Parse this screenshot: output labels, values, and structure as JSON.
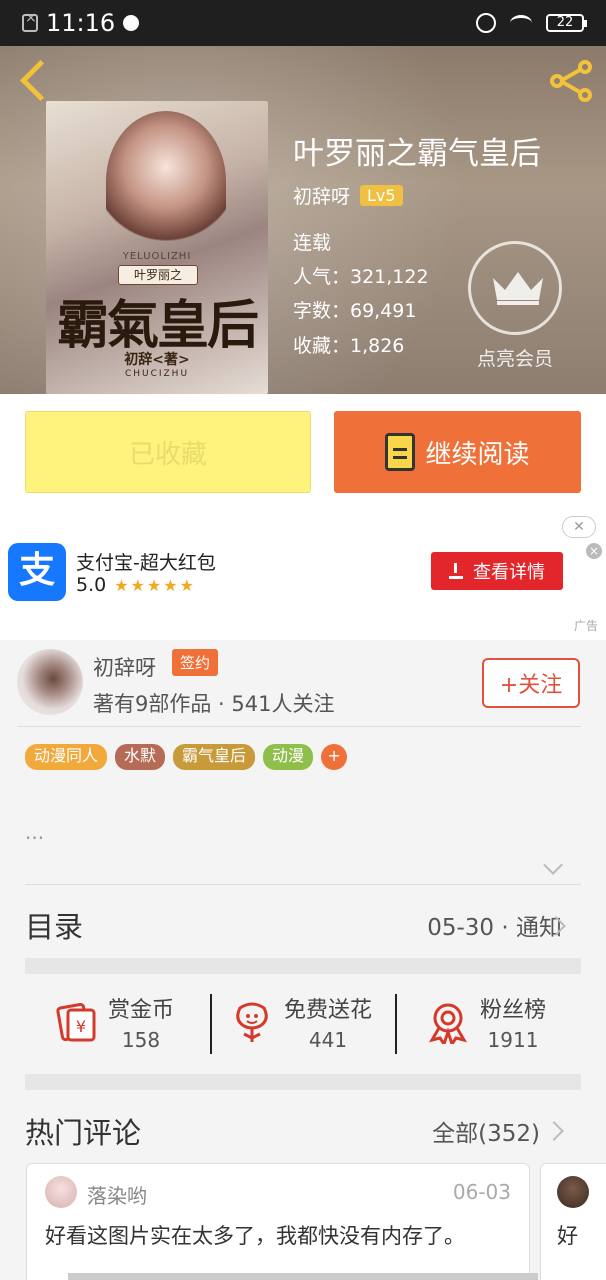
{
  "status_bar": {
    "time": "11:16",
    "battery": "22"
  },
  "book": {
    "title": "叶罗丽之霸气皇后",
    "author": "初辞呀",
    "level": "Lv5",
    "status": "连载",
    "popularity": "人气：321,122",
    "word_count": "字数：69,491",
    "favorites": "收藏：1,826",
    "vip_label": "点亮会员",
    "cover": {
      "subtitle": "YELUOLIZHI",
      "pill": "叶罗丽之",
      "big_title": "霸氣皇后",
      "author": "初辞<著>",
      "pinyin": "CHUCIZHU"
    }
  },
  "actions": {
    "collected": "已收藏",
    "continue_reading": "继续阅读"
  },
  "ad": {
    "close": "✕",
    "logo_char": "支",
    "title": "支付宝-超大红包",
    "rating": "5.0",
    "stars": "★★★★★",
    "button": "查看详情",
    "tag": "广告"
  },
  "author_info": {
    "name": "初辞呀",
    "sign_badge": "签约",
    "stats": "著有9部作品 · 541人关注",
    "follow": "+关注",
    "tags": [
      {
        "label": "动漫同人",
        "color": "#f2a93b"
      },
      {
        "label": "水默",
        "color": "#b56b55"
      },
      {
        "label": "霸气皇后",
        "color": "#c99a3a"
      },
      {
        "label": "动漫",
        "color": "#8fbf4a"
      }
    ],
    "tag_plus": "+",
    "description": "..."
  },
  "toc": {
    "title": "目录",
    "latest": "05-30 · 通知"
  },
  "stats": [
    {
      "label": "赏金币",
      "value": "158"
    },
    {
      "label": "免费送花",
      "value": "441"
    },
    {
      "label": "粉丝榜",
      "value": "1911"
    }
  ],
  "comments": {
    "title": "热门评论",
    "all": "全部(352)",
    "items": [
      {
        "user": "落染哟",
        "date": "06-03",
        "text": "好看这图片实在太多了，我都快没有内存了。"
      },
      {
        "text": "好"
      }
    ]
  },
  "colors": {
    "accent": "#f0703a",
    "collected_bg": "#fff27d",
    "vip_gold": "#f2c23a",
    "ad_red": "#e2262b",
    "alipay_blue": "#1678ff"
  }
}
